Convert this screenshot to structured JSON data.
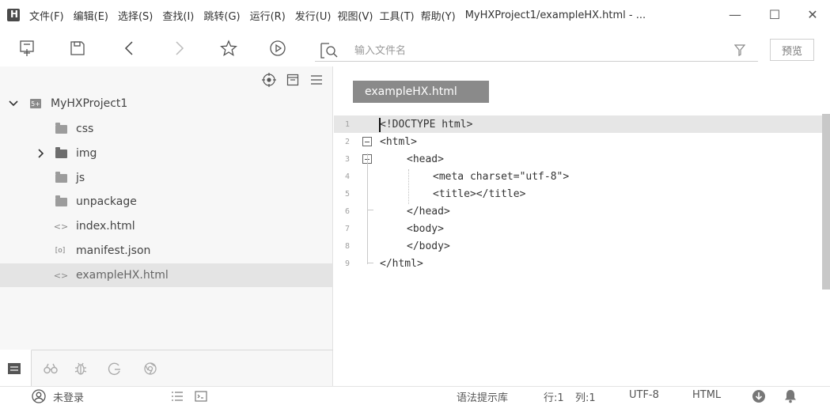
{
  "menubar": {
    "items": [
      "文件(F)",
      "编辑(E)",
      "选择(S)",
      "查找(I)",
      "跳转(G)",
      "运行(R)",
      "发行(U)",
      "视图(V)",
      "工具(T)",
      "帮助(Y)"
    ],
    "window_title": "MyHXProject1/exampleHX.html - ...",
    "minimize": "—",
    "maximize": "☐",
    "close": "✕"
  },
  "toolbar": {
    "search_placeholder": "输入文件名",
    "preview_label": "预览",
    "icons": [
      "new-file-icon",
      "save-icon",
      "back-icon",
      "forward-icon",
      "star-icon",
      "run-icon",
      "search-file-icon",
      "filter-icon"
    ]
  },
  "sidebar": {
    "project_name": "MyHXProject1",
    "items": [
      {
        "label": "css",
        "icon": "folder-icon"
      },
      {
        "label": "img",
        "icon": "folder-icon"
      },
      {
        "label": "js",
        "icon": "folder-icon"
      },
      {
        "label": "unpackage",
        "icon": "folder-icon"
      },
      {
        "label": "index.html",
        "icon": "html-file-icon"
      },
      {
        "label": "manifest.json",
        "icon": "json-file-icon"
      },
      {
        "label": "exampleHX.html",
        "icon": "html-file-icon"
      }
    ]
  },
  "editor": {
    "tab_label": "exampleHX.html",
    "lines": [
      {
        "num": "1",
        "text": "<!DOCTYPE html>"
      },
      {
        "num": "2",
        "text": "<html>"
      },
      {
        "num": "3",
        "text": "<head>"
      },
      {
        "num": "4",
        "text": "<meta charset=\"utf-8\">"
      },
      {
        "num": "5",
        "text": "<title></title>"
      },
      {
        "num": "6",
        "text": "</head>"
      },
      {
        "num": "7",
        "text": "<body>"
      },
      {
        "num": "8",
        "text": "</body>"
      },
      {
        "num": "9",
        "text": "</html>"
      }
    ]
  },
  "statusbar": {
    "login": "未登录",
    "syntax_lib": "语法提示库",
    "row": "行:1",
    "col": "列:1",
    "encoding": "UTF-8",
    "language": "HTML"
  }
}
